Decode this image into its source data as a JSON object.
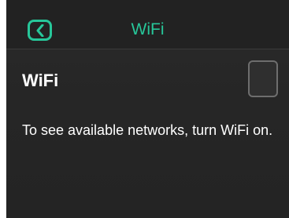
{
  "header": {
    "title": "WiFi",
    "back_icon": "chevron-left-icon"
  },
  "wifi_setting": {
    "label": "WiFi",
    "enabled": false
  },
  "hint": {
    "text": "To see available networks, turn WiFi on."
  },
  "colors": {
    "accent": "#27c79a",
    "background": "#262626",
    "text": "#ffffff"
  }
}
